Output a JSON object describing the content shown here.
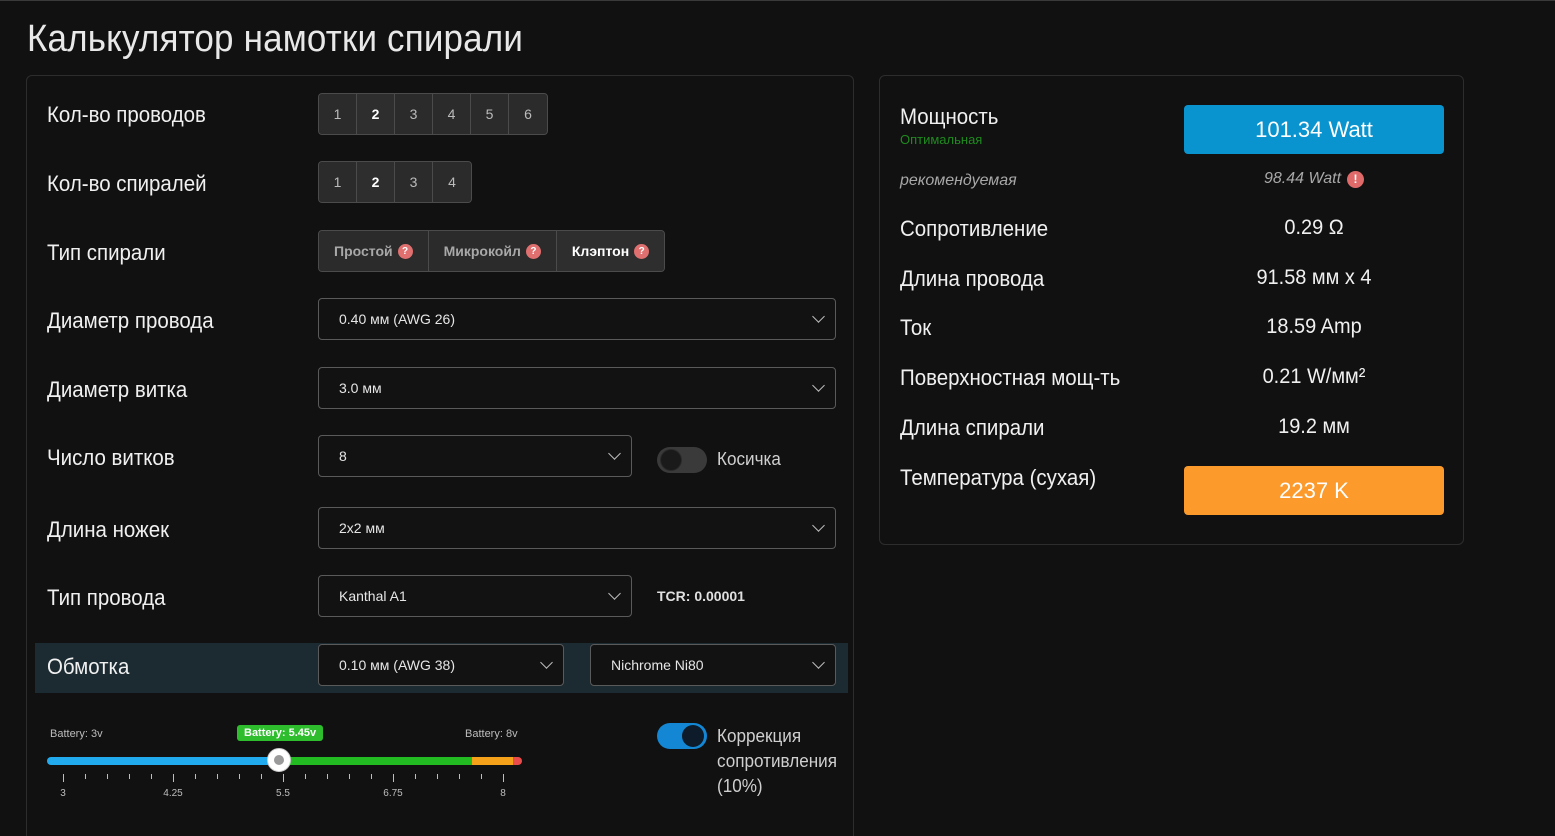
{
  "title": "Калькулятор намотки спирали",
  "form": {
    "wires": {
      "label": "Кол-во проводов",
      "options": [
        "1",
        "2",
        "3",
        "4",
        "5",
        "6"
      ],
      "selected": "2"
    },
    "coils": {
      "label": "Кол-во спиралей",
      "options": [
        "1",
        "2",
        "3",
        "4"
      ],
      "selected": "2"
    },
    "coil_type": {
      "label": "Тип спирали",
      "options": [
        "Простой",
        "Микрокойл",
        "Клэптон"
      ],
      "selected": "Клэптон",
      "help_glyph": "?"
    },
    "wire_diameter": {
      "label": "Диаметр провода",
      "value": "0.40 мм (AWG 26)"
    },
    "inner_diameter": {
      "label": "Диаметр витка",
      "value": "3.0 мм"
    },
    "wraps": {
      "label": "Число витков",
      "value": "8"
    },
    "braid": {
      "label": "Косичка",
      "enabled": false
    },
    "legs": {
      "label": "Длина ножек",
      "value": "2x2 мм"
    },
    "wire_type": {
      "label": "Тип провода",
      "value": "Kanthal A1",
      "tcr": "TCR: 0.00001"
    },
    "wrap_wire": {
      "label": "Обмотка",
      "diameter": "0.10 мм (AWG 38)",
      "material": "Nichrome Ni80"
    },
    "battery": {
      "min_label": "Battery: 3v",
      "current_label": "Battery: 5.45v",
      "max_label": "Battery: 8v",
      "min": 3,
      "max": 8,
      "value": 5.45,
      "ticks": [
        "3",
        "4.25",
        "5.5",
        "6.75",
        "8"
      ]
    },
    "resistance_correction": {
      "label_line1": "Коррекция",
      "label_line2": "сопротивления",
      "label_line3": "(10%)",
      "enabled": true
    }
  },
  "results": {
    "power": {
      "label": "Мощность",
      "status": "Оптимальная",
      "value": "101.34 Watt",
      "color": "#0a94cf"
    },
    "recommended": {
      "label": "рекомендуемая",
      "value": "98.44 Watt",
      "warn_glyph": "!"
    },
    "resistance": {
      "label": "Сопротивление",
      "value": "0.29 Ω"
    },
    "wire_length": {
      "label": "Длина провода",
      "value": "91.58 мм x 4"
    },
    "current": {
      "label": "Ток",
      "value": "18.59 Amp"
    },
    "heat_flux": {
      "label": "Поверхностная мощ-ть",
      "value": "0.21 W/мм²"
    },
    "coil_length": {
      "label": "Длина спирали",
      "value": "19.2 мм"
    },
    "temperature": {
      "label": "Температура (сухая)",
      "value": "2237 K",
      "color": "#fc9a2c"
    }
  }
}
